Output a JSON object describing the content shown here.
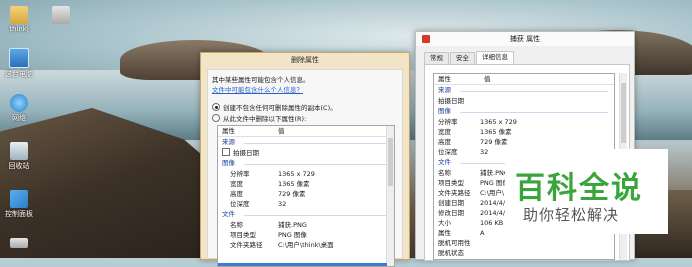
{
  "desktop": {
    "icons": [
      {
        "label": "thinkj",
        "icon": "folder-icon"
      },
      {
        "label": "",
        "icon": "image-icon"
      },
      {
        "label": "这台电脑",
        "icon": "computer-icon"
      },
      {
        "label": "网络",
        "icon": "network-icon"
      },
      {
        "label": "回收站",
        "icon": "recycle-bin-icon"
      },
      {
        "label": "控制面板",
        "icon": "control-panel-icon"
      },
      {
        "label": "",
        "icon": "drive-icon"
      }
    ]
  },
  "remove_dialog": {
    "title": "删除属性",
    "description": "其中某些属性可能包含个人信息。",
    "link": "文件中可能包含什么个人信息？",
    "option_copy": "创建不包含任何可删除属性的副本(C)。",
    "option_remove": "从此文件中删除以下属性(R):",
    "header_prop": "属性",
    "header_value": "值",
    "sections": [
      {
        "name": "来源",
        "rows": [
          {
            "k": "拍摄日期",
            "v": "",
            "checkbox": true
          }
        ]
      },
      {
        "name": "图像",
        "rows": [
          {
            "k": "分辨率",
            "v": "1365 x 729"
          },
          {
            "k": "宽度",
            "v": "1365 像素"
          },
          {
            "k": "高度",
            "v": "729 像素"
          },
          {
            "k": "位深度",
            "v": "32"
          }
        ]
      },
      {
        "name": "文件",
        "rows": [
          {
            "k": "名称",
            "v": "捕获.PNG"
          },
          {
            "k": "项目类型",
            "v": "PNG 图像"
          },
          {
            "k": "文件夹路径",
            "v": "C:\\用户\\think\\桌面"
          }
        ]
      }
    ]
  },
  "props_dialog": {
    "title": "捕获 属性",
    "tabs": [
      "常规",
      "安全",
      "详细信息"
    ],
    "active_tab": 2,
    "header_prop": "属性",
    "header_value": "值",
    "sections": [
      {
        "name": "来源",
        "rows": [
          {
            "k": "拍摄日期",
            "v": ""
          }
        ]
      },
      {
        "name": "图像",
        "rows": [
          {
            "k": "分辨率",
            "v": "1365 x 729"
          },
          {
            "k": "宽度",
            "v": "1365 像素"
          },
          {
            "k": "高度",
            "v": "729 像素"
          },
          {
            "k": "位深度",
            "v": "32"
          }
        ]
      },
      {
        "name": "文件",
        "rows": [
          {
            "k": "名称",
            "v": "捕获.PNG"
          },
          {
            "k": "项目类型",
            "v": "PNG 图像"
          },
          {
            "k": "文件夹路径",
            "v": "C:\\用户\\"
          },
          {
            "k": "创建日期",
            "v": "2014/4/"
          },
          {
            "k": "修改日期",
            "v": "2014/4/"
          },
          {
            "k": "大小",
            "v": "106 KB"
          },
          {
            "k": "属性",
            "v": "A"
          },
          {
            "k": "脱机可用性",
            "v": ""
          },
          {
            "k": "脱机状态",
            "v": ""
          }
        ]
      }
    ]
  },
  "watermark": {
    "brand": "百科全说",
    "slogan": "助你轻松解决"
  }
}
